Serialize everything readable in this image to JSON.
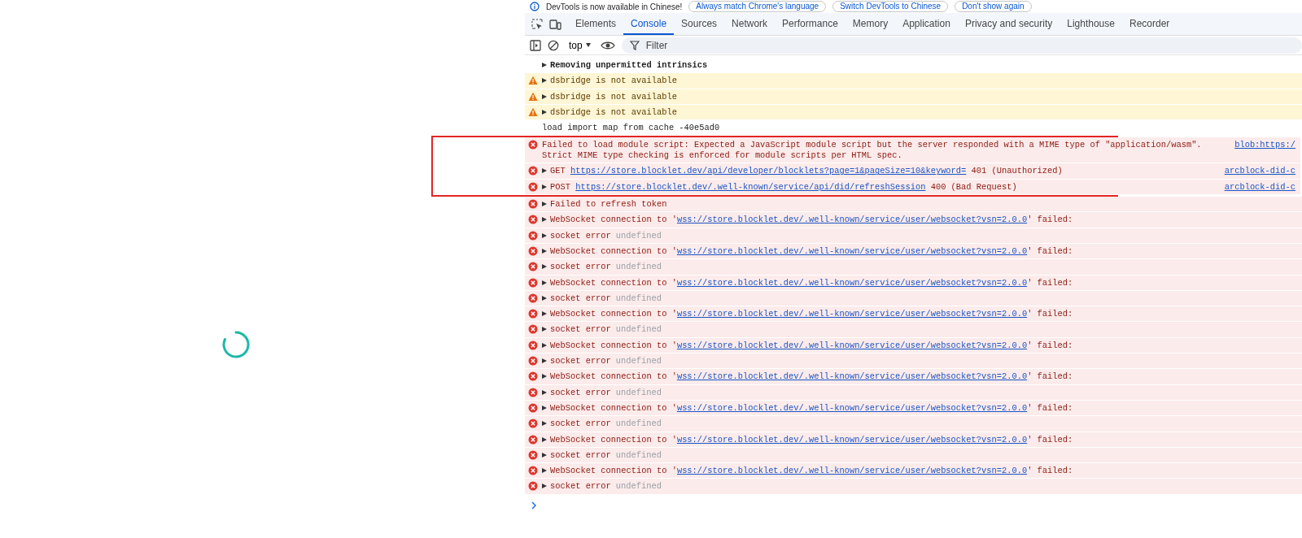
{
  "banner": {
    "text": "DevTools is now available in Chinese!",
    "buttons": [
      "Always match Chrome's language",
      "Switch DevTools to Chinese",
      "Don't show again"
    ]
  },
  "tabs": [
    {
      "label": "Elements",
      "selected": false
    },
    {
      "label": "Console",
      "selected": true
    },
    {
      "label": "Sources",
      "selected": false
    },
    {
      "label": "Network",
      "selected": false
    },
    {
      "label": "Performance",
      "selected": false
    },
    {
      "label": "Memory",
      "selected": false
    },
    {
      "label": "Application",
      "selected": false
    },
    {
      "label": "Privacy and security",
      "selected": false
    },
    {
      "label": "Lighthouse",
      "selected": false
    },
    {
      "label": "Recorder",
      "selected": false
    }
  ],
  "toolbar": {
    "context": "top",
    "filter_placeholder": "Filter"
  },
  "messages": [
    {
      "kind": "group",
      "expandable": true,
      "highlighted": false,
      "text": "Removing unpermitted intrinsics"
    },
    {
      "kind": "warning",
      "expandable": true,
      "highlighted": false,
      "text": "dsbridge is not available"
    },
    {
      "kind": "warning",
      "expandable": true,
      "highlighted": false,
      "text": "dsbridge is not available"
    },
    {
      "kind": "warning",
      "expandable": true,
      "highlighted": false,
      "text": "dsbridge is not available"
    },
    {
      "kind": "info",
      "expandable": false,
      "highlighted": false,
      "text": "load import map from cache -40e5ad0"
    },
    {
      "kind": "error",
      "expandable": false,
      "highlighted": true,
      "text": "Failed to load module script: Expected a JavaScript module script but the server responded with a MIME type of \"application/wasm\". Strict MIME type checking is enforced for module scripts per HTML spec.",
      "source": "blob:https:/"
    },
    {
      "kind": "error",
      "expandable": true,
      "highlighted": true,
      "text": "GET ",
      "link": "https://store.blocklet.dev/api/developer/blocklets?page=1&pageSize=10&keyword=",
      "suffix": " 401 (Unauthorized)",
      "source": "arcblock-did-c"
    },
    {
      "kind": "error",
      "expandable": true,
      "highlighted": true,
      "text": "POST ",
      "link": "https://store.blocklet.dev/.well-known/service/api/did/refreshSession",
      "suffix": " 400 (Bad Request)",
      "source": "arcblock-did-c"
    },
    {
      "kind": "error",
      "expandable": true,
      "highlighted": false,
      "text": "Failed to refresh token"
    },
    {
      "kind": "error",
      "expandable": true,
      "highlighted": false,
      "text": "WebSocket connection to '",
      "link": "wss://store.blocklet.dev/.well-known/service/user/websocket?vsn=2.0.0",
      "suffix": "' failed:"
    },
    {
      "kind": "error",
      "expandable": true,
      "highlighted": false,
      "text": "socket error",
      "value": "undefined"
    },
    {
      "kind": "error",
      "expandable": true,
      "highlighted": false,
      "text": "WebSocket connection to '",
      "link": "wss://store.blocklet.dev/.well-known/service/user/websocket?vsn=2.0.0",
      "suffix": "' failed:"
    },
    {
      "kind": "error",
      "expandable": true,
      "highlighted": false,
      "text": "socket error",
      "value": "undefined"
    },
    {
      "kind": "error",
      "expandable": true,
      "highlighted": false,
      "text": "WebSocket connection to '",
      "link": "wss://store.blocklet.dev/.well-known/service/user/websocket?vsn=2.0.0",
      "suffix": "' failed:"
    },
    {
      "kind": "error",
      "expandable": true,
      "highlighted": false,
      "text": "socket error",
      "value": "undefined"
    },
    {
      "kind": "error",
      "expandable": true,
      "highlighted": false,
      "text": "WebSocket connection to '",
      "link": "wss://store.blocklet.dev/.well-known/service/user/websocket?vsn=2.0.0",
      "suffix": "' failed:"
    },
    {
      "kind": "error",
      "expandable": true,
      "highlighted": false,
      "text": "socket error",
      "value": "undefined"
    },
    {
      "kind": "error",
      "expandable": true,
      "highlighted": false,
      "text": "WebSocket connection to '",
      "link": "wss://store.blocklet.dev/.well-known/service/user/websocket?vsn=2.0.0",
      "suffix": "' failed:"
    },
    {
      "kind": "error",
      "expandable": true,
      "highlighted": false,
      "text": "socket error",
      "value": "undefined"
    },
    {
      "kind": "error",
      "expandable": true,
      "highlighted": false,
      "text": "WebSocket connection to '",
      "link": "wss://store.blocklet.dev/.well-known/service/user/websocket?vsn=2.0.0",
      "suffix": "' failed:"
    },
    {
      "kind": "error",
      "expandable": true,
      "highlighted": false,
      "text": "socket error",
      "value": "undefined"
    },
    {
      "kind": "error",
      "expandable": true,
      "highlighted": false,
      "text": "WebSocket connection to '",
      "link": "wss://store.blocklet.dev/.well-known/service/user/websocket?vsn=2.0.0",
      "suffix": "' failed:"
    },
    {
      "kind": "error",
      "expandable": true,
      "highlighted": false,
      "text": "socket error",
      "value": "undefined"
    },
    {
      "kind": "error",
      "expandable": true,
      "highlighted": false,
      "text": "WebSocket connection to '",
      "link": "wss://store.blocklet.dev/.well-known/service/user/websocket?vsn=2.0.0",
      "suffix": "' failed:"
    },
    {
      "kind": "error",
      "expandable": true,
      "highlighted": false,
      "text": "socket error",
      "value": "undefined"
    },
    {
      "kind": "error",
      "expandable": true,
      "highlighted": false,
      "text": "WebSocket connection to '",
      "link": "wss://store.blocklet.dev/.well-known/service/user/websocket?vsn=2.0.0",
      "suffix": "' failed:"
    },
    {
      "kind": "error",
      "expandable": true,
      "highlighted": false,
      "text": "socket error",
      "value": "undefined"
    }
  ]
}
